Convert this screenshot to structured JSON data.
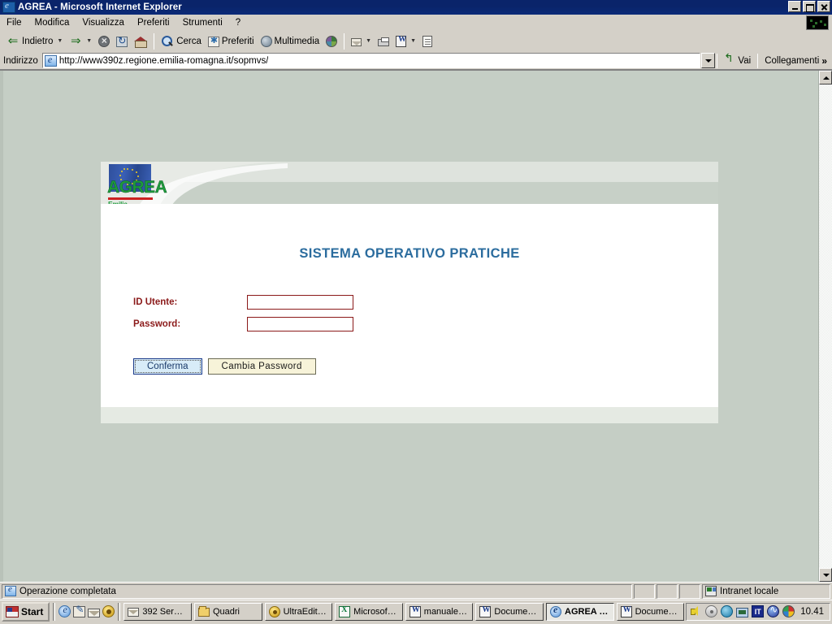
{
  "window": {
    "title": "AGREA - Microsoft Internet Explorer",
    "icon": "ie-document-icon",
    "controls": {
      "minimize": "_",
      "maximize": "□",
      "close": "×"
    }
  },
  "menubar": {
    "items": [
      {
        "label": "File"
      },
      {
        "label": "Modifica"
      },
      {
        "label": "Visualizza"
      },
      {
        "label": "Preferiti"
      },
      {
        "label": "Strumenti"
      },
      {
        "label": "?"
      }
    ]
  },
  "toolbar": {
    "buttons": [
      {
        "label": "Indietro",
        "icon": "back-arrow-icon",
        "caret": true
      },
      {
        "label": "",
        "icon": "forward-arrow-icon",
        "caret": true
      },
      {
        "label": "",
        "icon": "stop-icon"
      },
      {
        "label": "",
        "icon": "refresh-icon"
      },
      {
        "label": "",
        "icon": "home-icon"
      },
      {
        "label": "Cerca",
        "icon": "search-icon"
      },
      {
        "label": "Preferiti",
        "icon": "favorites-icon"
      },
      {
        "label": "Multimedia",
        "icon": "media-icon"
      },
      {
        "label": "",
        "icon": "history-icon"
      },
      {
        "label": "",
        "icon": "mail-icon",
        "caret": true
      },
      {
        "label": "",
        "icon": "print-icon"
      },
      {
        "label": "",
        "icon": "word-icon",
        "caret": true
      },
      {
        "label": "",
        "icon": "edit-icon"
      }
    ]
  },
  "addressbar": {
    "label": "Indirizzo",
    "url": "http://www390z.regione.emilia-romagna.it/sopmvs/",
    "placeholder": "",
    "go_label": "Vai",
    "links_label": "Collegamenti",
    "chevron": "»"
  },
  "page": {
    "logo": {
      "name": "AGREA",
      "subtitle": "Emilia-Romagna",
      "flag": "eu-flag"
    },
    "title": "SISTEMA OPERATIVO PRATICHE",
    "form": {
      "fields": [
        {
          "label": "ID Utente:",
          "value": "",
          "type": "text",
          "name": "id-utente"
        },
        {
          "label": "Password:",
          "value": "",
          "type": "password",
          "name": "password"
        }
      ],
      "buttons": [
        {
          "label": "Conferma",
          "name": "conferma"
        },
        {
          "label": "Cambia Password",
          "name": "cambia-password"
        }
      ]
    },
    "colors": {
      "title": "#2b6c9e",
      "label": "#8b1a1a",
      "field_border": "#8b1a1a",
      "page_bg": "#c5cec5",
      "card_bg": "#ffffff",
      "header_band": "#c7d0c7",
      "logo_green": "#1e9b3c",
      "logo_red": "#cc2222",
      "confirm_button_bg": "#d8ecf8",
      "change_button_bg": "#f7f3d9"
    }
  },
  "statusbar": {
    "message": "Operazione completata",
    "zone": "Intranet locale"
  },
  "taskbar": {
    "start_label": "Start",
    "quicklaunch": [
      {
        "name": "ie-icon"
      },
      {
        "name": "outlook-express-icon"
      },
      {
        "name": "mail-icon"
      },
      {
        "name": "ultraedit-icon"
      }
    ],
    "tasks": [
      {
        "label": "392 Ser…",
        "icon": "terminal-icon",
        "active": false
      },
      {
        "label": "Quadri",
        "icon": "folder-icon",
        "active": false
      },
      {
        "label": "UltraEdit…",
        "icon": "ultraedit-icon",
        "active": false
      },
      {
        "label": "Microsof…",
        "icon": "excel-icon",
        "active": false
      },
      {
        "label": "manuale…",
        "icon": "word-icon",
        "active": false
      },
      {
        "label": "Docume…",
        "icon": "word-icon",
        "active": false
      },
      {
        "label": "AGREA …",
        "icon": "ie-icon",
        "active": true
      },
      {
        "label": "Docume…",
        "icon": "word-icon",
        "active": false
      }
    ],
    "tray": [
      {
        "name": "volume-icon"
      },
      {
        "name": "disk-icon"
      },
      {
        "name": "network-icon"
      },
      {
        "name": "display-icon"
      },
      {
        "name": "language-icon",
        "text": "IT"
      },
      {
        "name": "sound-monitor-icon"
      },
      {
        "name": "color-icon"
      }
    ],
    "clock": "10.41"
  }
}
